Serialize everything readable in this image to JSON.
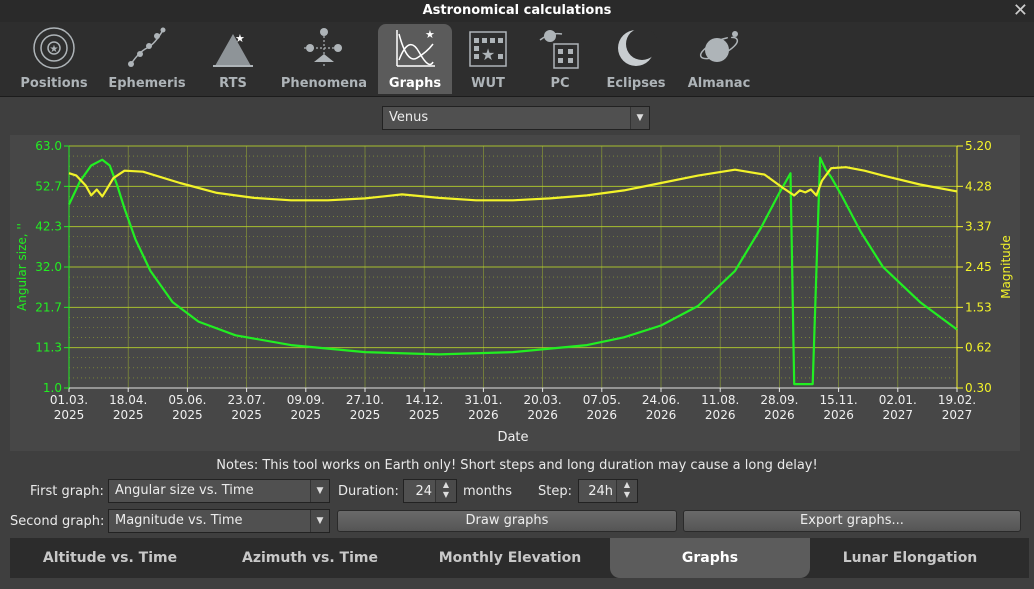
{
  "window": {
    "title": "Astronomical calculations"
  },
  "toolbar": {
    "items": [
      {
        "label": "Positions",
        "icon": "positions-icon"
      },
      {
        "label": "Ephemeris",
        "icon": "ephemeris-icon"
      },
      {
        "label": "RTS",
        "icon": "rts-icon"
      },
      {
        "label": "Phenomena",
        "icon": "phenomena-icon"
      },
      {
        "label": "Graphs",
        "icon": "graphs-icon",
        "active": true
      },
      {
        "label": "WUT",
        "icon": "wut-icon"
      },
      {
        "label": "PC",
        "icon": "pc-icon"
      },
      {
        "label": "Eclipses",
        "icon": "eclipses-icon"
      },
      {
        "label": "Almanac",
        "icon": "almanac-icon"
      }
    ]
  },
  "object_select": {
    "value": "Venus"
  },
  "notes": "Notes: This tool works on Earth only! Short steps and long duration may cause a long delay!",
  "controls": {
    "first_graph_label": "First graph:",
    "first_graph_value": "Angular size vs. Time",
    "second_graph_label": "Second graph:",
    "second_graph_value": "Magnitude vs. Time",
    "duration_label": "Duration:",
    "duration_value": "24",
    "duration_unit": "months",
    "step_label": "Step:",
    "step_value": "24h",
    "draw_button": "Draw graphs",
    "export_button": "Export graphs..."
  },
  "bottom_tabs": [
    {
      "label": "Altitude vs. Time"
    },
    {
      "label": "Azimuth vs. Time"
    },
    {
      "label": "Monthly Elevation"
    },
    {
      "label": "Graphs",
      "active": true
    },
    {
      "label": "Lunar Elongation"
    }
  ],
  "colors": {
    "series1": "#22ee22",
    "series2": "#f2f22a",
    "grid": "#b8d42a"
  },
  "chart_data": {
    "type": "line",
    "xlabel": "Date",
    "ylabel": "Angular size, ''",
    "y2label": "Magnitude",
    "ylim": [
      1.0,
      63.0
    ],
    "y2lim": [
      0.3,
      5.2
    ],
    "xlim": [
      0,
      24
    ],
    "yticks": [
      "1.0",
      "11.3",
      "21.7",
      "32.0",
      "42.3",
      "52.7",
      "63.0"
    ],
    "y2ticks": [
      "0.30",
      "0.62",
      "1.53",
      "2.45",
      "3.37",
      "4.28",
      "5.20"
    ],
    "xticks": [
      [
        "01.03.",
        "2025"
      ],
      [
        "18.04.",
        "2025"
      ],
      [
        "05.06.",
        "2025"
      ],
      [
        "23.07.",
        "2025"
      ],
      [
        "09.09.",
        "2025"
      ],
      [
        "27.10.",
        "2025"
      ],
      [
        "14.12.",
        "2025"
      ],
      [
        "31.01.",
        "2026"
      ],
      [
        "20.03.",
        "2026"
      ],
      [
        "07.05.",
        "2026"
      ],
      [
        "24.06.",
        "2026"
      ],
      [
        "11.08.",
        "2026"
      ],
      [
        "28.09.",
        "2026"
      ],
      [
        "15.11.",
        "2026"
      ],
      [
        "02.01.",
        "2027"
      ],
      [
        "19.02.",
        "2027"
      ]
    ],
    "series": [
      {
        "name": "Angular size vs. Time",
        "axis": "left",
        "x": [
          0,
          0.3,
          0.6,
          0.9,
          1.1,
          1.3,
          1.5,
          1.8,
          2.2,
          2.8,
          3.5,
          4.5,
          6,
          8,
          10,
          12,
          14,
          15,
          16,
          17,
          18,
          18.7,
          19.2,
          19.5,
          19.6,
          19.7,
          20.1,
          20.3,
          20.45,
          20.6,
          20.9,
          21.4,
          22,
          23,
          24
        ],
        "values": [
          48,
          54,
          58,
          59.5,
          58,
          53,
          47,
          39,
          31,
          23,
          18,
          14.5,
          12,
          10.2,
          9.6,
          10.2,
          12,
          14,
          17,
          22,
          31,
          42,
          51,
          56,
          2,
          2,
          2,
          60,
          57,
          55,
          50,
          41,
          32,
          23,
          16
        ]
      },
      {
        "name": "Magnitude vs. Time",
        "axis": "right",
        "x": [
          0,
          0.2,
          0.45,
          0.6,
          0.75,
          0.9,
          1.0,
          1.2,
          1.5,
          2,
          3,
          4,
          5,
          6,
          7,
          8,
          9,
          10,
          11,
          12,
          13,
          14,
          15,
          16,
          17,
          18,
          18.8,
          19.3,
          19.6,
          19.75,
          19.9,
          20.05,
          20.2,
          20.35,
          20.6,
          21,
          21.5,
          22,
          23,
          24
        ],
        "values": [
          4.65,
          4.6,
          4.4,
          4.2,
          4.32,
          4.18,
          4.3,
          4.55,
          4.7,
          4.68,
          4.45,
          4.25,
          4.15,
          4.1,
          4.1,
          4.14,
          4.22,
          4.15,
          4.1,
          4.1,
          4.14,
          4.2,
          4.3,
          4.45,
          4.6,
          4.72,
          4.62,
          4.35,
          4.2,
          4.3,
          4.26,
          4.32,
          4.2,
          4.5,
          4.75,
          4.77,
          4.7,
          4.6,
          4.42,
          4.28
        ]
      }
    ]
  }
}
